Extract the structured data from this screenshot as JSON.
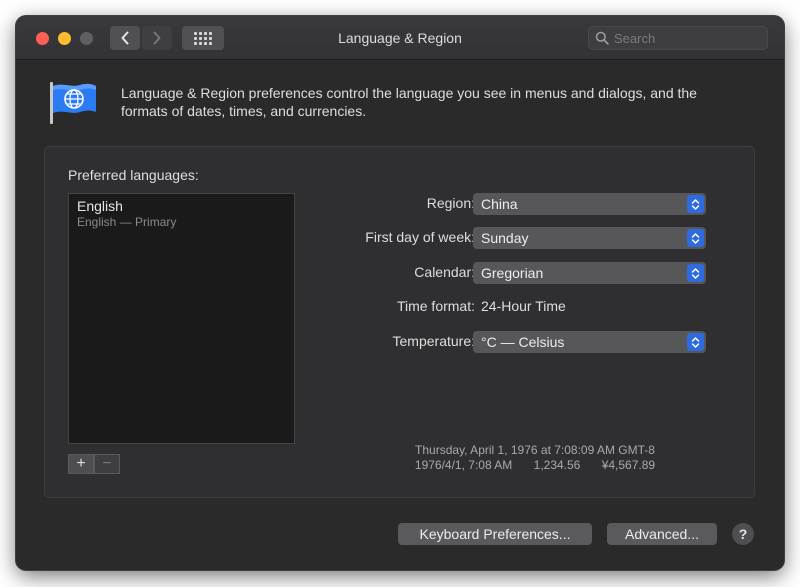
{
  "window": {
    "title": "Language & Region"
  },
  "search": {
    "placeholder": "Search"
  },
  "intro": "Language & Region preferences control the language you see in menus and dialogs, and the formats of dates, times, and currencies.",
  "languages": {
    "label": "Preferred languages:",
    "items": [
      {
        "name": "English",
        "detail": "English — Primary"
      }
    ],
    "add_label": "+",
    "remove_label": "−"
  },
  "settings": {
    "region": {
      "label": "Region:",
      "value": "China"
    },
    "first_day": {
      "label": "First day of week:",
      "value": "Sunday"
    },
    "calendar": {
      "label": "Calendar:",
      "value": "Gregorian"
    },
    "time_format": {
      "label": "Time format:",
      "value": "24-Hour Time"
    },
    "temperature": {
      "label": "Temperature:",
      "value": "°C — Celsius"
    }
  },
  "example": {
    "long_date": "Thursday, April 1, 1976 at 7:08:09 AM GMT-8",
    "short_date": "1976/4/1, 7:08 AM",
    "number": "1,234.56",
    "currency": "¥4,567.89"
  },
  "buttons": {
    "keyboard": "Keyboard Preferences...",
    "advanced": "Advanced...",
    "help": "?"
  },
  "colors": {
    "window_bg": "#2a2a2b",
    "popup_bg": "#575759",
    "accent": "#2e6be0",
    "close": "#fe5f57",
    "minimize": "#febc2e"
  },
  "icons": {
    "flag": "flag-globe-icon",
    "search": "search-icon",
    "back": "chevron-left-icon",
    "forward": "chevron-right-icon",
    "grid": "grid-icon",
    "popup_arrows": "up-down-arrows-icon"
  }
}
